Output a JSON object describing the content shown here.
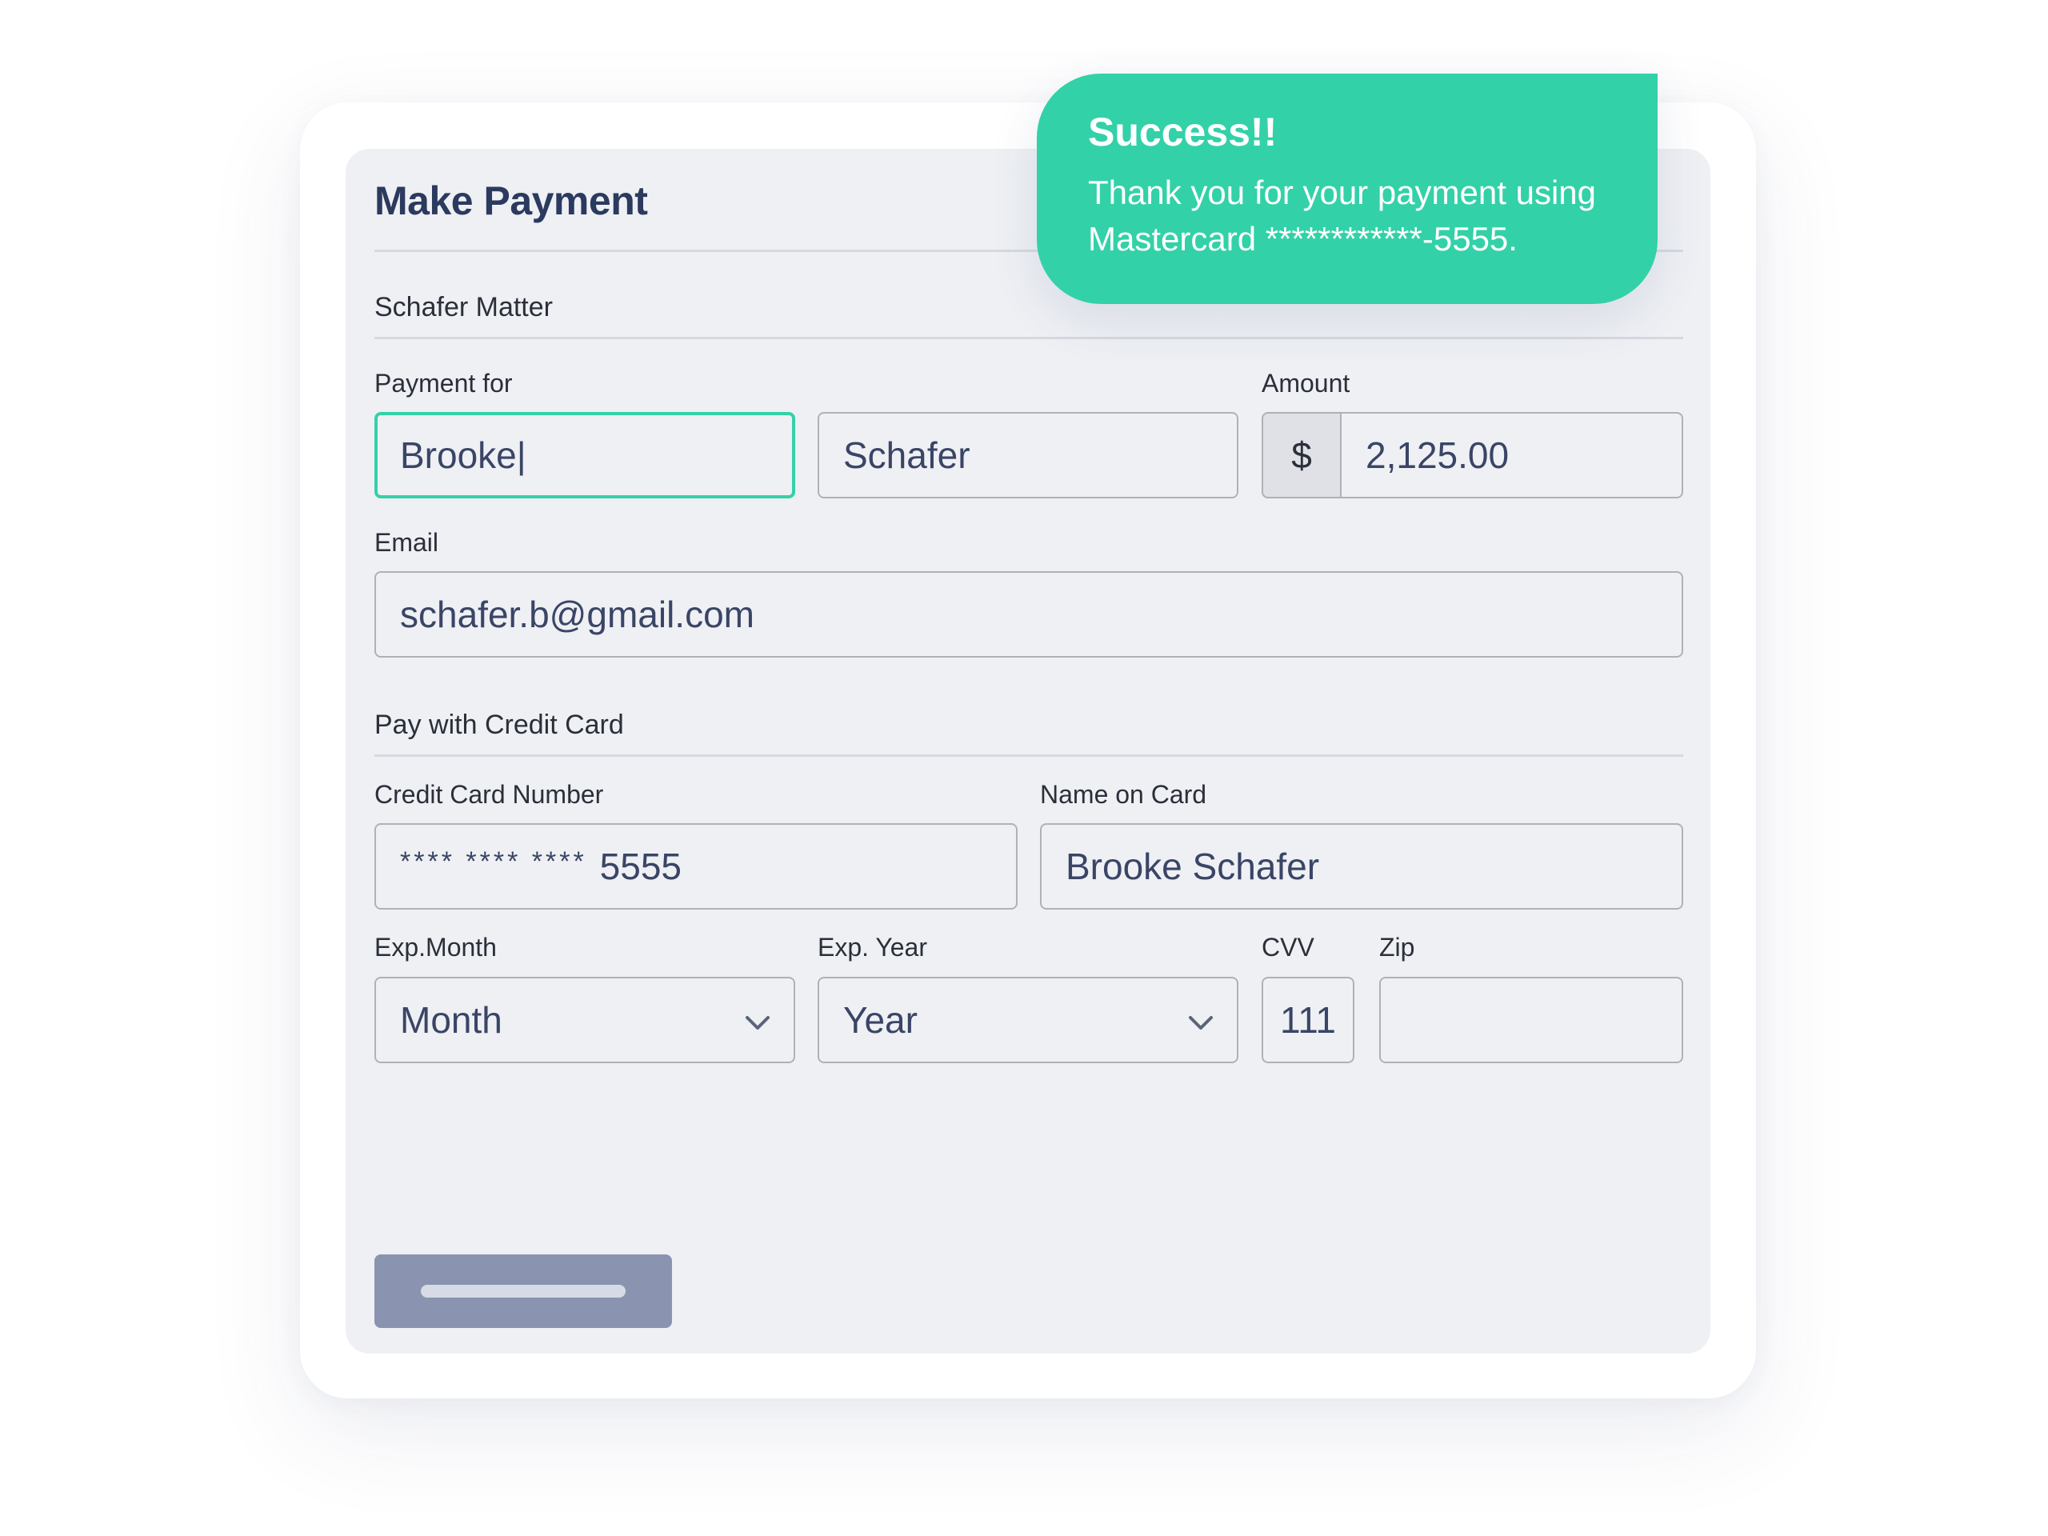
{
  "form": {
    "title": "Make Payment",
    "matter_label": "Schafer Matter",
    "payment_for_label": "Payment for",
    "first_name_value": "Brooke|",
    "last_name_value": "Schafer",
    "amount_label": "Amount",
    "currency_symbol": "$",
    "amount_value": "2,125.00",
    "email_label": "Email",
    "email_value": "schafer.b@gmail.com"
  },
  "card_section": {
    "title": "Pay with Credit Card",
    "card_number_label": "Credit Card Number",
    "card_number_mask": "**** **** ****",
    "card_number_last4": "5555",
    "name_label": "Name on Card",
    "name_value": "Brooke Schafer",
    "exp_month_label": "Exp.Month",
    "exp_month_value": "Month",
    "exp_year_label": "Exp. Year",
    "exp_year_value": "Year",
    "cvv_label": "CVV",
    "cvv_value": "111",
    "zip_label": "Zip",
    "zip_value": ""
  },
  "toast": {
    "title": "Success!!",
    "message": "Thank you for your payment using Mastercard ************-5555."
  },
  "icons": {
    "month_chevron": "chevron-down-icon",
    "year_chevron": "chevron-down-icon"
  },
  "colors": {
    "accent": "#33d1a8",
    "title": "#2b3a5e",
    "card_bg": "#eef0f4",
    "button": "#8a94b1"
  }
}
